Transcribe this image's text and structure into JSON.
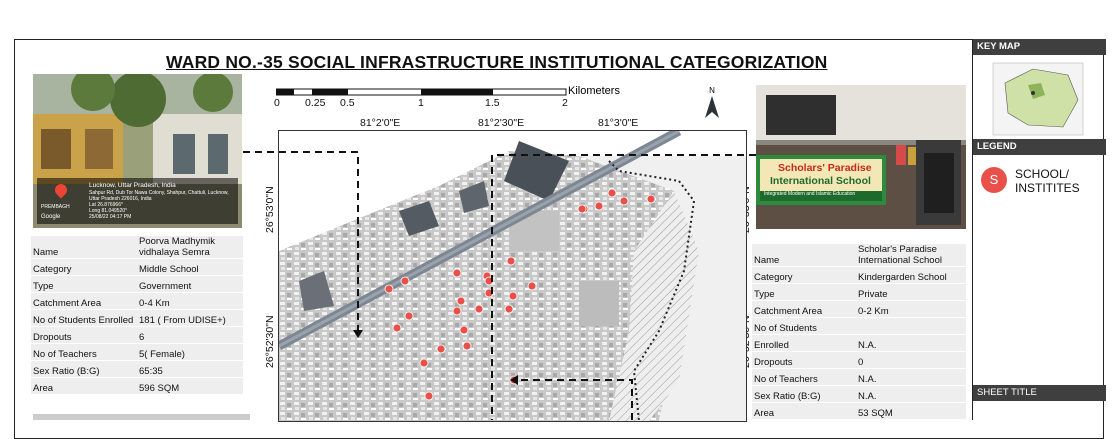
{
  "title": "WARD NO.-35  SOCIAL INFRASTRUCTURE INSTITUTIONAL CATEGORIZATION",
  "scale_bar": {
    "unit_label": "Kilometers",
    "ticks": [
      "0",
      "0.25",
      "0.5",
      "1",
      "1.5",
      "2"
    ]
  },
  "coordinates": {
    "longitudes": [
      "81°2'0\"E",
      "81°2'30\"E",
      "81°3'0\"E"
    ],
    "latitudes": [
      "26°53'0\"N",
      "26°52'30\"N"
    ]
  },
  "geotag_photo": {
    "location": "Lucknow, Uttar Pradesh, India",
    "address": "Sahpur Rd, Dub Tor Nawa Colony, Shahpur, Chattuli, Lucknow, Uttar Pradesh 226016, India",
    "lat": "Lat 26.876966°",
    "long": "Long 81.049520°",
    "timestamp": "25/08/22 04:17 PM",
    "brand": "PREMBAGH",
    "google": "Google"
  },
  "left_school": {
    "rows": [
      {
        "key": "Name",
        "value": "Poorva Madhymik vidhalaya Semra"
      },
      {
        "key": "Category",
        "value": "Middle School"
      },
      {
        "key": "Type",
        "value": "Government"
      },
      {
        "key": "Catchment Area",
        "value": "0-4 Km"
      },
      {
        "key": "No of Students Enrolled",
        "value": "181 ( From UDISE+)"
      },
      {
        "key": "Dropouts",
        "value": "6"
      },
      {
        "key": "No of Teachers",
        "value": "5( Female)"
      },
      {
        "key": "Sex Ratio (B:G)",
        "value": "65:35"
      },
      {
        "key": "Area",
        "value": "596 SQM"
      }
    ]
  },
  "right_school": {
    "sign_line1": "Scholars' Paradise",
    "sign_line2": "International School",
    "sign_line3": "Integrated Modern and Islamic Education",
    "rows": [
      {
        "key": "Name",
        "value": "Scholar's  Paradise International School"
      },
      {
        "key": "Category",
        "value": "Kindergarden School"
      },
      {
        "key": "Type",
        "value": "Private"
      },
      {
        "key": "Catchment Area",
        "value": "0-2 Km"
      },
      {
        "key": "No of Students",
        "value": ""
      },
      {
        "key": "Enrolled",
        "value": "N.A."
      },
      {
        "key": "Dropouts",
        "value": "0"
      },
      {
        "key": "No of Teachers",
        "value": "N.A."
      },
      {
        "key": "Sex Ratio (B:G)",
        "value": "N.A."
      },
      {
        "key": "Area",
        "value": "53 SQM"
      }
    ]
  },
  "side_panel": {
    "key_map": "KEY MAP",
    "legend": "LEGEND",
    "legend_symbol": "S",
    "legend_label": "SCHOOL/ INSTITITES",
    "sheet_title": "SHEET TITLE"
  },
  "colors": {
    "school_marker": "#e9504a",
    "panel_header": "#3f3f3f",
    "road": "#7d8792"
  }
}
